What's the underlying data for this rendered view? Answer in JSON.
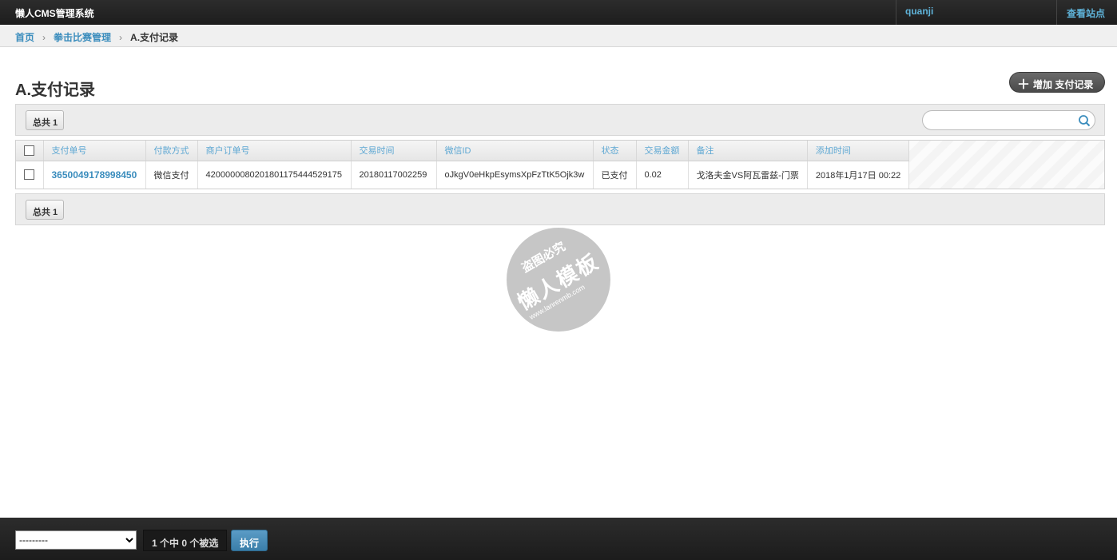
{
  "header": {
    "app_title": "懒人CMS管理系统",
    "user_name": "quanji",
    "view_site": "查看站点"
  },
  "breadcrumb": {
    "home": "首页",
    "section": "拳击比赛管理",
    "current": "A.支付记录",
    "separator": "›"
  },
  "page": {
    "title": "A.支付记录",
    "add_button": "增加 支付记录",
    "total_label": "总共 1",
    "search_placeholder": ""
  },
  "table": {
    "columns": [
      "支付单号",
      "付款方式",
      "商户订单号",
      "交易时间",
      "微信ID",
      "状态",
      "交易金额",
      "备注",
      "添加时间"
    ],
    "rows": [
      {
        "payment_id": "3650049178998450",
        "pay_method": "微信支付",
        "merchant_order": "4200000080201801175444529175",
        "trade_time": "20180117002259",
        "wechat_id": "oJkgV0eHkpEsymsXpFzTtK5Ojk3w",
        "status": "已支付",
        "amount": "0.02",
        "note": "戈洛夫金VS阿瓦雷兹-门票",
        "added_time": "2018年1月17日 00:22"
      }
    ]
  },
  "watermark": {
    "line1": "盗图必究",
    "line2": "懒人模板",
    "line3": "www.lanrenmb.com"
  },
  "footer": {
    "action_select_value": "---------",
    "selected_count": "1 个中 0 个被选",
    "run_button": "执行"
  },
  "colors": {
    "accent": "#3b8dbd",
    "header_bg": "#222222",
    "button_blue": "#4a8bb5"
  }
}
